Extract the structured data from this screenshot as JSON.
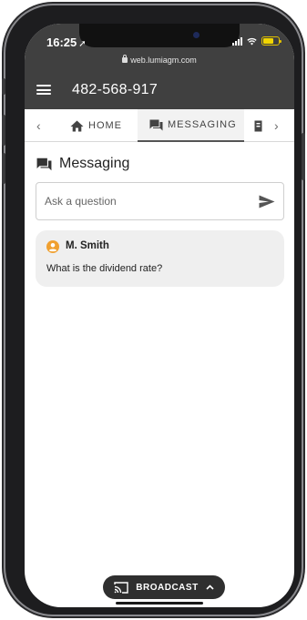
{
  "status_bar": {
    "time": "16:25",
    "url": "web.lumiagm.com"
  },
  "header": {
    "meeting_id": "482-568-917"
  },
  "tabs": [
    {
      "label": "HOME",
      "icon": "home-icon",
      "active": false
    },
    {
      "label": "MESSAGING",
      "icon": "messaging-icon",
      "active": true
    }
  ],
  "messaging": {
    "title": "Messaging",
    "input_placeholder": "Ask a question",
    "messages": [
      {
        "author": "M. Smith",
        "text": "What is the dividend rate?"
      }
    ]
  },
  "broadcast": {
    "label": "BROADCAST"
  },
  "colors": {
    "appbar": "#404040",
    "accent_user": "#f0a030",
    "card_bg": "#efefef"
  }
}
